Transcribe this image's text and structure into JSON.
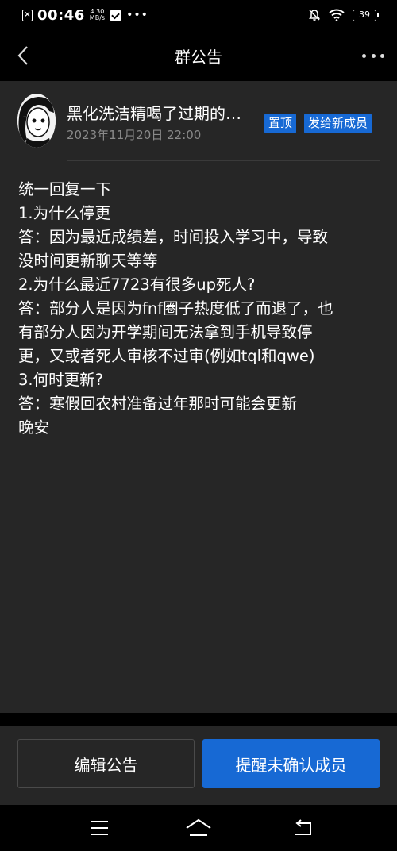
{
  "status_bar": {
    "time": "00:46",
    "speed_value": "4.30",
    "speed_unit": "MB/s",
    "dots": "•••",
    "battery": "39"
  },
  "nav": {
    "title": "群公告"
  },
  "post": {
    "author": "黑化洗洁精喝了过期的…",
    "time": "2023年11月20日 22:00",
    "badge_pinned": "置顶",
    "badge_send": "发给新成员",
    "lines": [
      "统一回复一下",
      "1.为什么停更",
      "答：因为最近成绩差，时间投入学习中，导致",
      "没时间更新聊天等等",
      "2.为什么最近7723有很多up死人?",
      "答：部分人是因为fnf圈子热度低了而退了，也",
      "有部分人因为开学期间无法拿到手机导致停",
      "更，又或者死人审核不过审(例如tql和qwe)",
      "3.何时更新?",
      "答：寒假回农村准备过年那时可能会更新",
      "晚安"
    ]
  },
  "actions": {
    "edit_label": "编辑公告",
    "remind_label": "提醒未确认成员"
  },
  "colors": {
    "accent": "#1769d4",
    "content_bg": "#262626",
    "page_bg": "#000000",
    "muted_text": "#8a8a8a"
  }
}
